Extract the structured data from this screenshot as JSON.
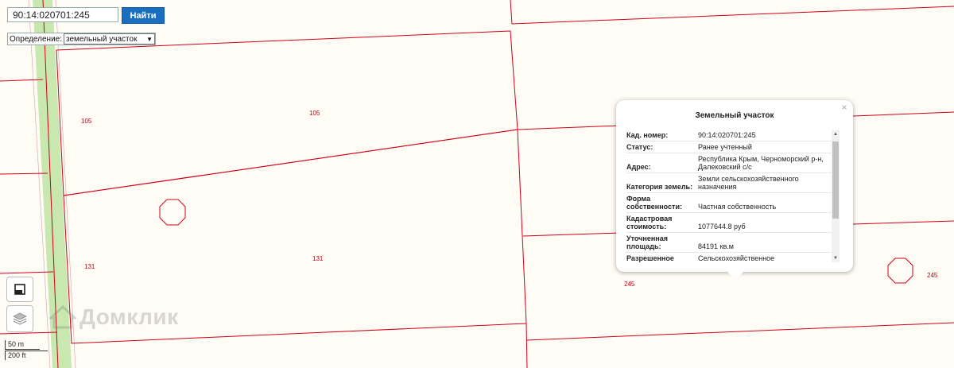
{
  "search": {
    "value": "90:14:020701:245",
    "button_label": "Найти"
  },
  "definition": {
    "label": "Определение:",
    "selected": "земельный участок"
  },
  "parcel_labels": [
    "105",
    "105",
    "131",
    "131",
    "245",
    "245"
  ],
  "scale": {
    "metric": "50 m",
    "imperial": "200 ft"
  },
  "watermark": "Домклик",
  "popup": {
    "title": "Земельный участок",
    "close": "×",
    "rows": [
      {
        "key": "Кад. номер:",
        "value": "90:14:020701:245"
      },
      {
        "key": "Статус:",
        "value": "Ранее учтенный"
      },
      {
        "key": "Адрес:",
        "value": "Республика Крым, Черноморский р-н, Далековский с/с"
      },
      {
        "key": "Категория земель:",
        "value": "Земли сельскохозяйственного назначения"
      },
      {
        "key": "Форма собственности:",
        "value": "Частная собственность"
      },
      {
        "key": "Кадастровая стоимость:",
        "value": "1077644.8 руб"
      },
      {
        "key": "Уточненная площадь:",
        "value": "84191 кв.м"
      },
      {
        "key": "Разрешенное",
        "value": "Сельскохозяйственное"
      }
    ]
  },
  "colors": {
    "parcel_border": "#d0001c",
    "road": "#c8e8b0",
    "button": "#1a6fc0",
    "background": "#fefcf4"
  }
}
